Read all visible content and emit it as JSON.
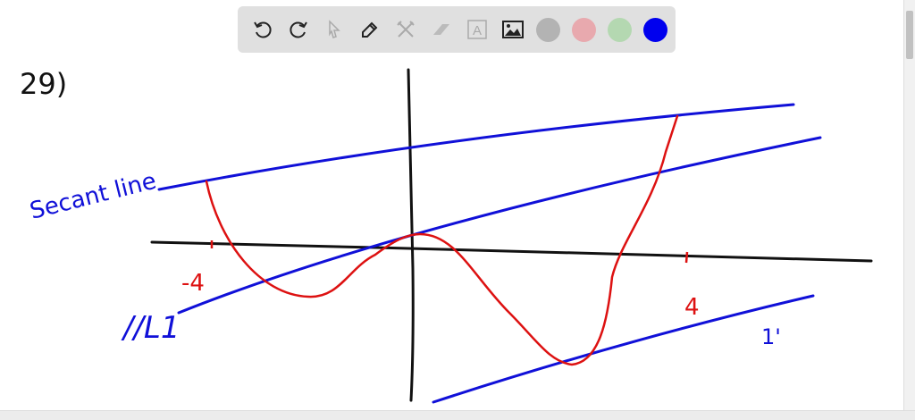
{
  "toolbar": {
    "tools": [
      {
        "name": "undo-icon",
        "enabled": true
      },
      {
        "name": "redo-icon",
        "enabled": true
      },
      {
        "name": "select-icon",
        "enabled": false
      },
      {
        "name": "pen-icon",
        "enabled": true
      },
      {
        "name": "tools-icon",
        "enabled": false
      },
      {
        "name": "eraser-icon",
        "enabled": false
      },
      {
        "name": "text-icon",
        "enabled": false
      },
      {
        "name": "image-icon",
        "enabled": true
      }
    ],
    "text_tool_glyph": "A",
    "colors": [
      {
        "name": "gray",
        "hex": "#b3b3b3"
      },
      {
        "name": "red",
        "hex": "#e8a9ae"
      },
      {
        "name": "green",
        "hex": "#b4d8b1"
      },
      {
        "name": "blue",
        "hex": "#0000ee"
      }
    ]
  },
  "drawing": {
    "problem_label": "29)",
    "secant_label": "Secant line",
    "tick_neg": "-4",
    "tick_pos": "4",
    "parallel_label": "//L1",
    "prime_label": "1'",
    "ink_colors": {
      "black": "#111111",
      "blue": "#1010d8",
      "red": "#dd1111"
    }
  }
}
